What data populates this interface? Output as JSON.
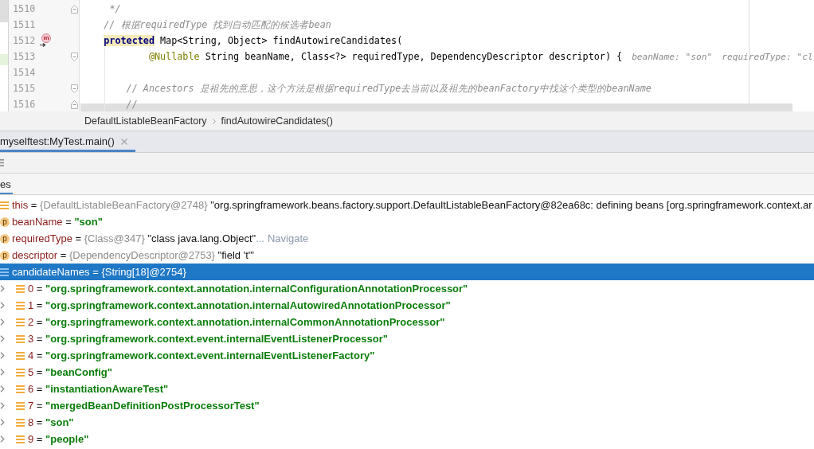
{
  "editor": {
    "lines": [
      {
        "number": "1510",
        "fold_end": true,
        "code": [
          {
            "kind": "comment",
            "text": "     */"
          }
        ]
      },
      {
        "number": "1511",
        "code": [
          {
            "kind": "comment",
            "text": "    // 根据requiredType 找到自动匹配的候选者bean"
          }
        ]
      },
      {
        "number": "1512",
        "marker": {
          "kind": "override",
          "letter": "m"
        },
        "code": [
          {
            "kind": "keyword",
            "text": "    protected",
            "highlighted": true
          },
          {
            "kind": "plain",
            "text": " Map<String, Object> findAutowireCandidates("
          }
        ]
      },
      {
        "number": "1513",
        "fold_start": true,
        "code": [
          {
            "kind": "annotation",
            "text": "            @Nullable"
          },
          {
            "kind": "plain",
            "text": " String beanName, Class<?> requiredType, DependencyDescriptor descriptor) {"
          }
        ],
        "hints": [
          "beanName: \"son\"",
          "requiredType: \"cl"
        ]
      },
      {
        "number": "1514"
      },
      {
        "number": "1515",
        "fold_start": true,
        "code": [
          {
            "kind": "comment",
            "text": "        // Ancestors 是祖先的意思，这个方法是根据requiredType去当前以及祖先的beanFactory中找这个类型的beanName"
          }
        ]
      },
      {
        "number": "1516",
        "fold_end": true,
        "code": [
          {
            "kind": "comment",
            "text": "        //"
          }
        ]
      }
    ]
  },
  "breadcrumb": [
    "DefaultListableBeanFactory",
    "findAutowireCandidates()"
  ],
  "debug": {
    "tabs": [
      {
        "label": "myselftest:MyTest.main()",
        "selected": true,
        "closable": true
      }
    ],
    "panel_tabs": [
      {
        "label": "es",
        "selected": true
      }
    ],
    "variables": [
      {
        "kind": "object",
        "name": "this",
        "operator": "=",
        "type": "{DefaultListableBeanFactory@2748}",
        "value": {
          "kind": "text",
          "text": "\"org.springframework.beans.factory.support.DefaultListableBeanFactory@82ea68c: defining beans [org.springframework.context.ar"
        },
        "selected": false
      },
      {
        "kind": "parameter",
        "badge": "p",
        "name": "beanName",
        "operator": "=",
        "value": {
          "kind": "string",
          "text": "\"son\""
        },
        "selected": false
      },
      {
        "kind": "parameter",
        "badge": "p",
        "name": "requiredType",
        "operator": "=",
        "type": "{Class@347}",
        "value": {
          "kind": "text",
          "text": "\"class java.lang.Object\""
        },
        "more": "...",
        "link": "Navigate",
        "selected": false
      },
      {
        "kind": "parameter",
        "badge": "p",
        "name": "descriptor",
        "operator": "=",
        "type": "{DependencyDescriptor@2753}",
        "value": {
          "kind": "text",
          "text": "\"field 't'\""
        },
        "selected": false
      },
      {
        "kind": "local",
        "name": "candidateNames",
        "operator": "=",
        "type": "{String[18]@2754}",
        "selected": true,
        "children": [
          {
            "kind": "element",
            "name": "0",
            "operator": "=",
            "value": {
              "kind": "string",
              "text": "\"org.springframework.context.annotation.internalConfigurationAnnotationProcessor\""
            },
            "selected": false,
            "expanded": false
          },
          {
            "kind": "element",
            "name": "1",
            "operator": "=",
            "value": {
              "kind": "string",
              "text": "\"org.springframework.context.annotation.internalAutowiredAnnotationProcessor\""
            },
            "selected": false,
            "expanded": false
          },
          {
            "kind": "element",
            "name": "2",
            "operator": "=",
            "value": {
              "kind": "string",
              "text": "\"org.springframework.context.annotation.internalCommonAnnotationProcessor\""
            },
            "selected": false,
            "expanded": false
          },
          {
            "kind": "element",
            "name": "3",
            "operator": "=",
            "value": {
              "kind": "string",
              "text": "\"org.springframework.context.event.internalEventListenerProcessor\""
            },
            "selected": false,
            "expanded": false
          },
          {
            "kind": "element",
            "name": "4",
            "operator": "=",
            "value": {
              "kind": "string",
              "text": "\"org.springframework.context.event.internalEventListenerFactory\""
            },
            "selected": false,
            "expanded": false
          },
          {
            "kind": "element",
            "name": "5",
            "operator": "=",
            "value": {
              "kind": "string",
              "text": "\"beanConfig\""
            },
            "selected": false,
            "expanded": false
          },
          {
            "kind": "element",
            "name": "6",
            "operator": "=",
            "value": {
              "kind": "string",
              "text": "\"instantiationAwareTest\""
            },
            "selected": false,
            "expanded": false
          },
          {
            "kind": "element",
            "name": "7",
            "operator": "=",
            "value": {
              "kind": "string",
              "text": "\"mergedBeanDefinitionPostProcessorTest\""
            },
            "selected": false,
            "expanded": false
          },
          {
            "kind": "element",
            "name": "8",
            "operator": "=",
            "value": {
              "kind": "string",
              "text": "\"son\""
            },
            "selected": false,
            "expanded": false
          },
          {
            "kind": "element",
            "name": "9",
            "operator": "=",
            "value": {
              "kind": "string",
              "text": "\"people\""
            },
            "selected": false,
            "expanded": false
          }
        ]
      }
    ]
  }
}
